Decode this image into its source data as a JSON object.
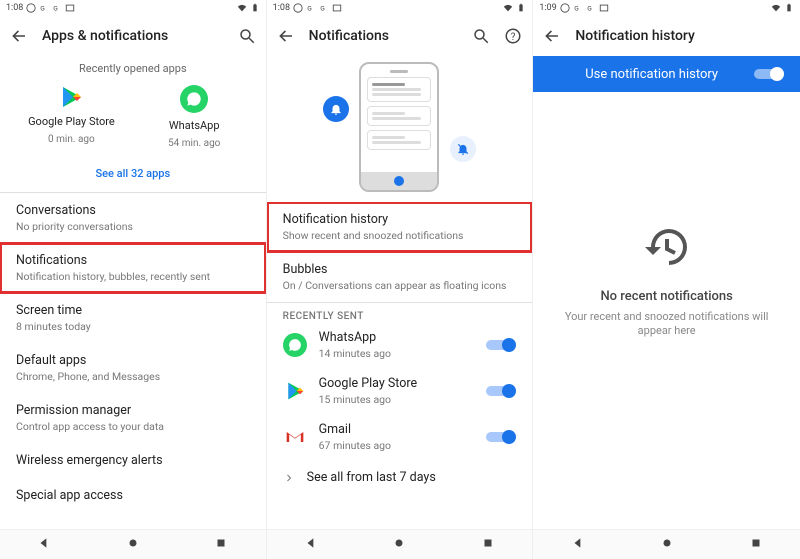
{
  "screen1": {
    "status": {
      "time": "1:08",
      "icons": [
        "whatsapp",
        "google",
        "google",
        "image"
      ]
    },
    "title": "Apps & notifications",
    "recently_opened_label": "Recently opened apps",
    "apps": [
      {
        "name": "Google Play Store",
        "sub": "0 min. ago",
        "icon": "play-store"
      },
      {
        "name": "WhatsApp",
        "sub": "54 min. ago",
        "icon": "whatsapp"
      }
    ],
    "see_all": "See all 32 apps",
    "items": [
      {
        "title": "Conversations",
        "sub": "No priority conversations"
      },
      {
        "title": "Notifications",
        "sub": "Notification history, bubbles, recently sent",
        "highlight": true
      },
      {
        "title": "Screen time",
        "sub": "8 minutes today"
      },
      {
        "title": "Default apps",
        "sub": "Chrome, Phone, and Messages"
      },
      {
        "title": "Permission manager",
        "sub": "Control app access to your data"
      },
      {
        "title": "Wireless emergency alerts",
        "sub": ""
      },
      {
        "title": "Special app access",
        "sub": ""
      }
    ]
  },
  "screen2": {
    "status": {
      "time": "1:08",
      "icons": [
        "whatsapp",
        "google",
        "google",
        "image"
      ]
    },
    "title": "Notifications",
    "items": [
      {
        "title": "Notification history",
        "sub": "Show recent and snoozed notifications",
        "highlight": true
      },
      {
        "title": "Bubbles",
        "sub": "On / Conversations can appear as floating icons"
      }
    ],
    "recently_sent_label": "RECENTLY SENT",
    "recent": [
      {
        "name": "WhatsApp",
        "sub": "14 minutes ago",
        "icon": "whatsapp",
        "on": true
      },
      {
        "name": "Google Play Store",
        "sub": "15 minutes ago",
        "icon": "play-store",
        "on": true
      },
      {
        "name": "Gmail",
        "sub": "67 minutes ago",
        "icon": "gmail",
        "on": true
      }
    ],
    "see_all": "See all from last 7 days"
  },
  "screen3": {
    "status": {
      "time": "1:09",
      "icons": [
        "whatsapp",
        "google",
        "google",
        "image"
      ]
    },
    "title": "Notification history",
    "banner": "Use notification history",
    "empty_title": "No recent notifications",
    "empty_sub": "Your recent and snoozed notifications will appear here"
  }
}
